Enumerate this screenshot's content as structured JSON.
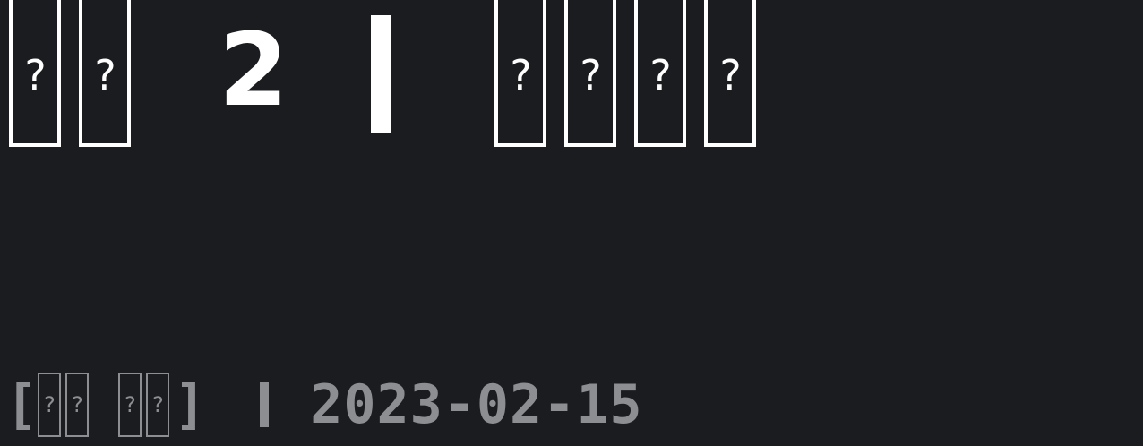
{
  "headline": {
    "glyphs_before": [
      "?",
      "?"
    ],
    "number": "2",
    "glyphs_after": [
      "?",
      "?",
      "?",
      "?"
    ]
  },
  "meta": {
    "open_bracket": "[",
    "tag_glyphs_a": [
      "?",
      "?"
    ],
    "tag_glyphs_b": [
      "?",
      "?"
    ],
    "close_bracket": "]",
    "date": "2023-02-15"
  },
  "colors": {
    "background": "#1b1c20",
    "headline_text": "#ffffff",
    "meta_text": "#8d8e92"
  }
}
